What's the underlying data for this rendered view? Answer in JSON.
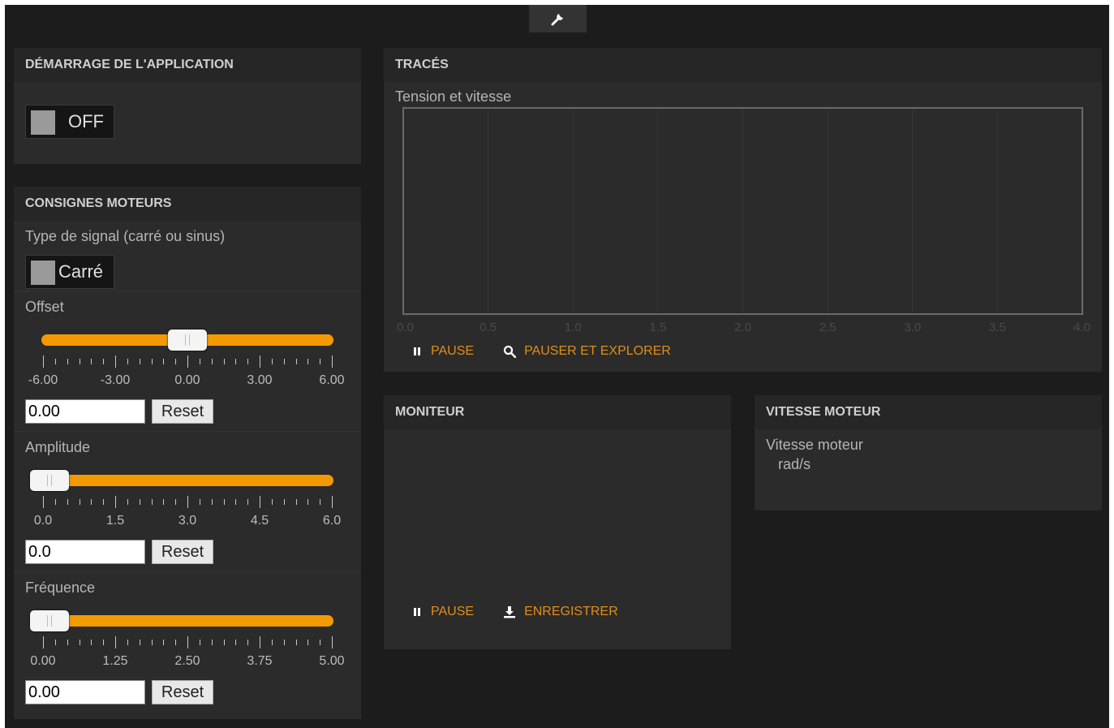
{
  "panels": {
    "startup": {
      "title": "DÉMARRAGE DE L'APPLICATION",
      "toggle_label": "OFF"
    },
    "motor_setpoints": {
      "title": "CONSIGNES MOTEURS",
      "signal_type_label": "Type de signal (carré ou sinus)",
      "signal_toggle_label": "Carré",
      "sliders": [
        {
          "label": "Offset",
          "min": -6,
          "max": 6,
          "value": 0,
          "input_value": "0.00",
          "reset_label": "Reset",
          "tick_labels": [
            "-6.00",
            "-3.00",
            "0.00",
            "3.00",
            "6.00"
          ]
        },
        {
          "label": "Amplitude",
          "min": 0,
          "max": 6,
          "value": 0,
          "input_value": "0.0",
          "reset_label": "Reset",
          "tick_labels": [
            "0.0",
            "1.5",
            "3.0",
            "4.5",
            "6.0"
          ]
        },
        {
          "label": "Fréquence",
          "min": 0,
          "max": 5,
          "value": 0,
          "input_value": "0.00",
          "reset_label": "Reset",
          "tick_labels": [
            "0.00",
            "1.25",
            "2.50",
            "3.75",
            "5.00"
          ]
        }
      ]
    },
    "traces": {
      "title": "TRACÉS",
      "chart_title": "Tension et vitesse",
      "pause_label": "PAUSE",
      "explore_label": "PAUSER ET EXPLORER"
    },
    "monitor": {
      "title": "MONITEUR",
      "pause_label": "PAUSE",
      "save_label": "ENREGISTRER"
    },
    "motor_speed": {
      "title": "VITESSE MOTEUR",
      "label": "Vitesse moteur",
      "unit": "rad/s"
    }
  },
  "colors": {
    "accent": "#f39a00",
    "action_text": "#e08e1a",
    "background": "#1c1c1c",
    "panel": "#2b2b2b"
  },
  "icons": {
    "top_tab": "wrench-icon",
    "pause": "pause-icon",
    "explore": "search-icon",
    "save": "download-icon"
  },
  "chart_data": {
    "type": "line",
    "title": "Tension et vitesse",
    "x_ticks": [
      "0.0",
      "0.5",
      "1.0",
      "1.5",
      "2.0",
      "2.5",
      "3.0",
      "3.5",
      "4.0"
    ],
    "xlim": [
      0,
      4
    ],
    "series": [],
    "grid": true
  }
}
